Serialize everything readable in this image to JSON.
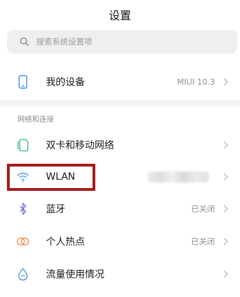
{
  "header": {
    "title": "设置"
  },
  "search": {
    "placeholder": "搜索系统设置项"
  },
  "device": {
    "label": "我的设备",
    "value": "MIUI 10.3"
  },
  "network_section": {
    "header": "网络和连接",
    "items": [
      {
        "label": "双卡和移动网络",
        "value": "",
        "icon": "sim-card-icon"
      },
      {
        "label": "WLAN",
        "value": "",
        "icon": "wifi-icon"
      },
      {
        "label": "蓝牙",
        "value": "已关闭",
        "icon": "bluetooth-icon"
      },
      {
        "label": "个人热点",
        "value": "已关闭",
        "icon": "hotspot-icon"
      },
      {
        "label": "流量使用情况",
        "value": "",
        "icon": "data-usage-icon"
      }
    ]
  },
  "colors": {
    "accent_blue": "#3a8ee6",
    "highlight_red": "#a81a1a",
    "hotspot_orange": "#f08a3c",
    "bluetooth_purple": "#6a6cd8",
    "sim_green": "#35b37e"
  }
}
